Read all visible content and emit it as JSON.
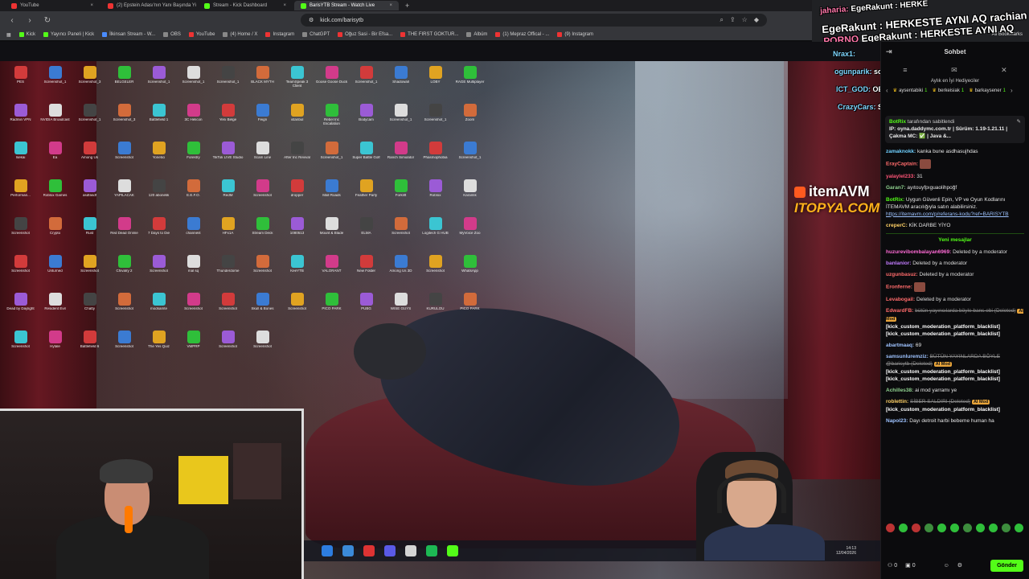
{
  "tabs": [
    {
      "title": "YouTube",
      "active": false
    },
    {
      "title": "(2) Epstein Adası'nın Yanı Başında Yü",
      "active": false
    },
    {
      "title": "Stream - Kick Dashboard",
      "active": false
    },
    {
      "title": "BarisYTB Stream - Watch Live",
      "active": true
    }
  ],
  "address": {
    "url": "kick.com/barisytb"
  },
  "bookmarks": [
    "Kick",
    "Yayıncı Paneli | Kick",
    "İlkinsan Stream - W...",
    "OBS",
    "YouTube",
    "(4) Home / X",
    "Instagram",
    "ChatGPT",
    "Oğuz Sasi - Bir Efsa...",
    "THE FIRST GOKTUR...",
    "Albüm",
    "(1) Mepraz Offical - ...",
    "(9) Instagram"
  ],
  "all_bookmarks": "All Bookmarks",
  "overlay_top": [
    {
      "user": "jaharia:",
      "text": "EgeRakunt : HERKE"
    },
    {
      "user": "",
      "text": "EgeRakunt : HERKESTE AYNI AQ rachian :"
    },
    {
      "user": "PORNO",
      "text": "EgeRakunt : HERKESTE AYNI AQ"
    }
  ],
  "stream_overlay": [
    {
      "user": "Nrax1:",
      "text": ""
    },
    {
      "user": "ogunparik:",
      "text": "sorun ne"
    },
    {
      "user": "ICT_GOD:",
      "text": "OE BOT"
    },
    {
      "user": "CrazyCars:",
      "text": "SIKTIK SENI BOT"
    }
  ],
  "desktop_icons": [
    "PES",
    "Screenshot_1",
    "Screenshot_3",
    "BELGELER",
    "Screenshot_1",
    "Screenshot_1",
    "Screenshot_1",
    "BLACK MYTH",
    "TeamSpeak 3 Client",
    "Goose Goose Duck",
    "Screenshot_1",
    "Shadowall",
    "LOBY",
    "RAGE Multiplayer",
    "Radmin VPN",
    "NVIDIA Broadcast",
    "Screenshot_1",
    "Screenshot_3",
    "Battlefield 1",
    "3C Helicon",
    "Yeni Belge",
    "Feign",
    "ıstanbul",
    "Rebel Inc Escalation",
    "Bodycam",
    "Screenshot_1",
    "Screenshot_1",
    "Zoom",
    "Isekai",
    "Ea",
    "Among Us",
    "Screenshot",
    "Yonetici",
    "Forestry",
    "TikTok LIVE Studio",
    "Scam Line",
    "After Inc Revival",
    "Screenshot_1",
    "Super Battle Golf",
    "Ranch Simulator",
    "Phasmophobia",
    "Screenshot_1",
    "Performan...",
    "Roblox Games",
    "asdfasdf",
    "YAPILACAK",
    "120 abonelik",
    "E.E.F.O.",
    "RedM",
    "Screenshot",
    "dropper",
    "Mall Roads",
    "Feather Party",
    "Forklift",
    "Roblox",
    "Karanlık",
    "Screenshot",
    "Crypto",
    "Rust",
    "Red Dead Online",
    "7 Days to Die",
    "channel4",
    "HFx1A",
    "Stream Deck",
    "1080513",
    "Mount & Blade",
    "ELMA",
    "Screenshot",
    "Logitech G HUB",
    "MyVoice Zoo",
    "Screenshot",
    "Unturned",
    "Screenshot",
    "Chivalry 2",
    "Screenshot",
    "mal sq",
    "Thunderdome",
    "Screenshot",
    "KeeYTB",
    "VALORANT",
    "New Folder",
    "Among Us 3D",
    "Screenshot",
    "WhatsApp",
    "Dead by Daylight",
    "Resident Evil",
    "Chatty",
    "Screenshot",
    "modsamte",
    "Screenshot",
    "Screenshot",
    "Skull & Bones",
    "Screenshot",
    "PICO PARK",
    "PUBG",
    "WISE GUYS",
    "KURULOU",
    "PICO PARK",
    "Screenshot",
    "Hytale",
    "Battlefield 6",
    "Screenshot",
    "The Yes Quiz",
    "VMPRP",
    "Screenshot",
    "Screenshot"
  ],
  "sponsor": {
    "line1": "itemAVM",
    "line2": "ITOPYA.COM"
  },
  "clock": {
    "time": "14:13",
    "date": "12/04/2026"
  },
  "chat": {
    "title": "Sohbet",
    "gifters_title": "Aylık en İyi Hediyeciler",
    "gifters": [
      {
        "name": "aysentabiki",
        "count": "1"
      },
      {
        "name": "berkeisiak",
        "count": "1"
      },
      {
        "name": "barkaysener",
        "count": "1"
      }
    ],
    "pinned": {
      "bot": "BotRix",
      "by_text": "tarafından sabitlendi",
      "message": "IP: oyna.daddymc.com.tr | Sürüm: 1.19-1.21.11 | Çakma MC: ✅ | Java &..."
    },
    "messages_before": [
      {
        "user": "zamaknokk:",
        "color": "#6fd0ff",
        "text": "kanka bune asdhasujhdas"
      },
      {
        "user": "ErayCaptain:",
        "color": "#ff6b6b",
        "text": "",
        "emote": true
      },
      {
        "user": "yalaylel233:",
        "color": "#ff5577",
        "text": "31"
      },
      {
        "user": "Garan7:",
        "color": "#8fd18f",
        "text": "ayıtouyfpıguaolihpoğf"
      },
      {
        "user": "BotRix:",
        "color": "#53fc18",
        "text": "Uygun Güvenli Epin, VP ve Oyun Kodlarını İTEMAVM aracılığıyla satın alabilirsiniz.",
        "link": "https://itemavm.com/p/referans-kodu?ref=BARISYTB"
      },
      {
        "user": "creperC:",
        "color": "#ffd166",
        "text": "KİK DARBE YİYO"
      }
    ],
    "new_messages_label": "Yeni mesajlar",
    "messages_after": [
      {
        "user": "huzurevibombalayan6969:",
        "color": "#ff6bd6",
        "text": "Deleted by a moderator"
      },
      {
        "user": "banlanior:",
        "color": "#c27cff",
        "text": "Deleted by a moderator"
      },
      {
        "user": "uzgunbasuz:",
        "color": "#ff6b6b",
        "text": "Deleted by a moderator"
      },
      {
        "user": "Eronferne:",
        "color": "#ff6b6b",
        "text": "",
        "emote": true
      },
      {
        "user": "Levabogail:",
        "color": "#ff6b6b",
        "text": "Deleted by a moderator"
      },
      {
        "user": "EdwardFB:",
        "color": "#ff6b6b",
        "strike": "bütün yayıncılarda böyle bans ebi (Deleted)",
        "mod": "AI Mod",
        "blacklist": [
          "[kick_custom_moderation_platform_blacklist]",
          "[kick_custom_moderation_platform_blacklist]"
        ]
      },
      {
        "user": "abartmaaq:",
        "color": "#9ec3ff",
        "text": "69"
      },
      {
        "user": "samsunluremziz:",
        "color": "#9ec3ff",
        "strike": "BÜTÜN YAYINLARDA BÖYLE @barisytb (Deleted)",
        "mod": "AI Mod",
        "blacklist": [
          "[kick_custom_moderation_platform_blacklist]",
          "[kick_custom_moderation_platform_blacklist]"
        ]
      },
      {
        "user": "Achilles38:",
        "color": "#8fd18f",
        "text": "ai mod yarramı ye"
      },
      {
        "user": "roblettin:",
        "color": "#ffd166",
        "strike": "SİBER SALDIRI (Deleted)",
        "mod": "AI Mod",
        "blacklist": [
          "[kick_custom_moderation_platform_blacklist]"
        ]
      },
      {
        "user": "Napol23:",
        "color": "#9ec3ff",
        "text": "Dayı detroit harbi bebeme human ha"
      }
    ],
    "bottom": {
      "count1": "0",
      "count2": "0",
      "send": "Gönder"
    }
  }
}
